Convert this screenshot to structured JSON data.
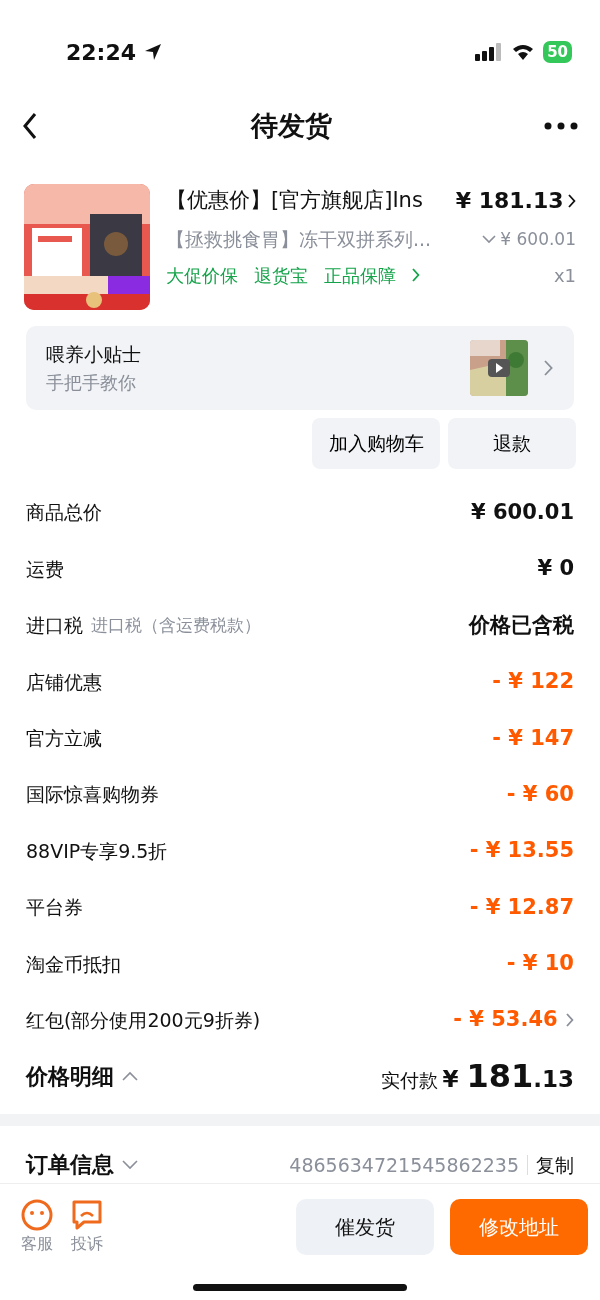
{
  "status_bar": {
    "time": "22:24",
    "battery": "50"
  },
  "header": {
    "title": "待发货"
  },
  "product": {
    "kind": "picture",
    "title": "【优惠价】[官方旗舰店]Ins",
    "price": "¥ 181.13",
    "subtitle": "【拯救挑食胃】冻干双拼系列...",
    "original_price": "¥ 600.01",
    "services": [
      "大促价保",
      "退货宝",
      "正品保障"
    ],
    "quantity": "x1"
  },
  "tips": {
    "title": "喂养小贴士",
    "subtitle": "手把手教你"
  },
  "actions": [
    "加入购物车",
    "退款"
  ],
  "fees": [
    {
      "label": "商品总价",
      "value": "¥ 600.01",
      "kind": "normal",
      "chevron": false
    },
    {
      "label": "运费",
      "value": "¥ 0",
      "kind": "normal",
      "chevron": false
    },
    {
      "label": "进口税",
      "note": "进口税（含运费税款）",
      "value": "价格已含税",
      "kind": "normal",
      "chevron": false
    },
    {
      "label": "店铺优惠",
      "value": "- ¥ 122",
      "kind": "discount",
      "chevron": false
    },
    {
      "label": "官方立减",
      "value": "- ¥ 147",
      "kind": "discount",
      "chevron": false
    },
    {
      "label": "国际惊喜购物券",
      "value": "- ¥ 60",
      "kind": "discount",
      "chevron": false
    },
    {
      "label": "88VIP专享9.5折",
      "value": "- ¥ 13.55",
      "kind": "discount",
      "chevron": false
    },
    {
      "label": "平台券",
      "value": "- ¥ 12.87",
      "kind": "discount",
      "chevron": false
    },
    {
      "label": "淘金币抵扣",
      "value": "- ¥ 10",
      "kind": "discount",
      "chevron": false
    },
    {
      "label": "红包(部分使用200元9折券)",
      "value": "- ¥ 53.46",
      "kind": "discount",
      "chevron": true
    }
  ],
  "summary": {
    "title": "价格明细",
    "expanded": true,
    "paid_label": "实付款",
    "currency": "¥",
    "amount_int": "181",
    "amount_dec": ".13"
  },
  "order_info": {
    "title": "订单信息",
    "expanded": false,
    "order_no": "4865634721545862235",
    "copy": "复制"
  },
  "bottom_bar": {
    "tools": [
      "客服",
      "投诉"
    ],
    "buttons": [
      {
        "label": "催发货",
        "primary": false
      },
      {
        "label": "修改地址",
        "primary": true
      }
    ]
  }
}
